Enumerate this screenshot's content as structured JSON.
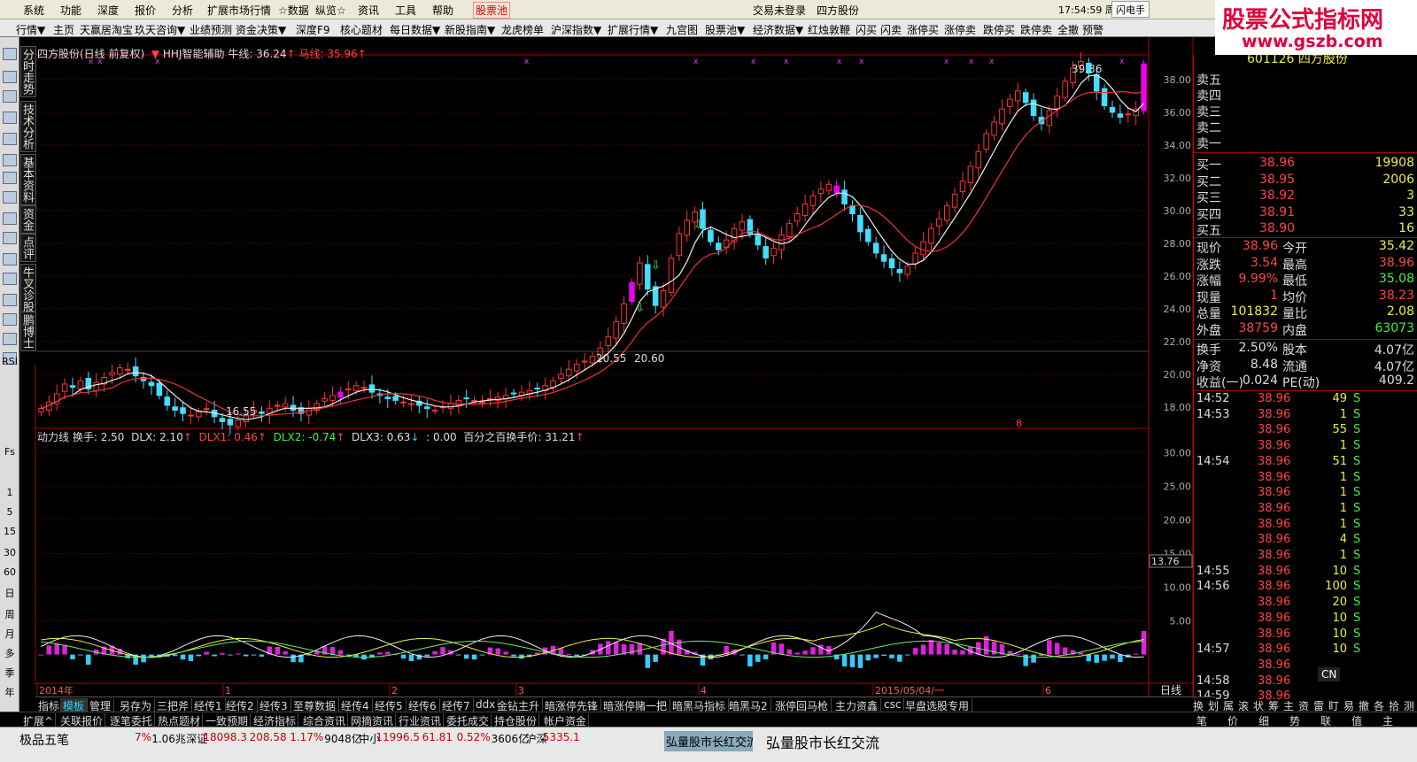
{
  "menubar": {
    "items": [
      "系统",
      "功能",
      "深度",
      "报价",
      "分析",
      "扩展市场行情",
      "☆数据",
      "纵览☆",
      "资讯",
      "工具",
      "帮助"
    ],
    "hot": "股票池",
    "login": "交易未登录",
    "stock": "四方股份",
    "clock": "17:54:59 周日",
    "flash": "闪电手"
  },
  "logo": {
    "line1": "股票公式指标网",
    "line2": "www.gszb.com"
  },
  "toolbar": [
    "行情▼",
    "主页",
    "天赢居淘宝",
    "玖天咨询▼",
    "业绩预测",
    "资金决策▼",
    "深度F9",
    "核心题材",
    "每日数据▼",
    "新股指南▼",
    "龙虎榜单",
    "沪深指数▼",
    "扩展行情▼",
    "九宫图",
    "股票池▼",
    "经济数据▼",
    "红烛敦鞭",
    "闪买",
    "闪卖",
    "涨停买",
    "涨停卖",
    "跌停买",
    "跌停卖",
    "全撤",
    "预警"
  ],
  "vtabs": [
    "分时走势",
    "技术分析",
    "基本资料",
    "资金",
    "点评",
    "牛叉诊股",
    "鹏博士"
  ],
  "leftbar": {
    "labels": [
      "RSI",
      "Fs",
      "1",
      "5",
      "15",
      "30",
      "60",
      "日",
      "周",
      "月",
      "多",
      "季",
      "年"
    ]
  },
  "main_header": {
    "name": "四方股份(日线 前复权)",
    "indicator": "HHJ智能辅助",
    "niu_label": "牛线:",
    "niu_val": "36.24",
    "ma_label": "马线:",
    "ma_val": "35.96"
  },
  "sub_header": {
    "name": "动力线",
    "hs_label": "换手:",
    "hs_val": "2.50",
    "dlx_label": "DLX:",
    "dlx_val": "2.10",
    "dlx1_label": "DLX1:",
    "dlx1_val": "0.46",
    "dlx2_label": "DLX2:",
    "dlx2_val": "-0.74",
    "dlx3_label": "DLX3:",
    "dlx3_val": "0.63",
    "zero": ": 0.00",
    "pct_label": "百分之百换手价:",
    "pct_val": "31.21"
  },
  "chart_data": {
    "type": "candlestick",
    "main_axis": {
      "ticks": [
        "38.00",
        "36.00",
        "34.00",
        "32.00",
        "30.00",
        "28.00",
        "26.00",
        "24.00",
        "22.00",
        "20.00",
        "18.00"
      ],
      "ylim": [
        16.8,
        39.4
      ]
    },
    "sub_axis": {
      "ticks": [
        "30.00",
        "25.00",
        "20.00",
        "15.00",
        "13.76",
        "10.00",
        "5.00"
      ],
      "ylim": [
        -4,
        31.5
      ]
    },
    "annotations": {
      "high": "39.36",
      "low": "16.55",
      "mid1": "20.55",
      "mid2": "20.60",
      "marker": "8"
    },
    "x_labels": [
      "2014年",
      "1",
      "2",
      "3",
      "4",
      "2015/05/04/一",
      "6"
    ],
    "period": "日线",
    "series": {
      "close": [
        17.9,
        18.3,
        18.8,
        19.4,
        19.2,
        19.6,
        19.1,
        19.5,
        19.8,
        20.1,
        20.4,
        20.3,
        19.9,
        19.6,
        19.3,
        18.7,
        18.1,
        17.8,
        17.6,
        17.5,
        17.7,
        17.9,
        17.4,
        17.1,
        16.9,
        17.2,
        17.5,
        17.8,
        17.6,
        17.9,
        18.1,
        18.2,
        17.8,
        17.6,
        17.9,
        18.2,
        18.5,
        18.7,
        18.9,
        19.1,
        19.3,
        19.2,
        18.9,
        18.7,
        18.5,
        18.4,
        18.3,
        18.2,
        18.1,
        17.9,
        17.8,
        18.0,
        18.2,
        18.4,
        18.5,
        18.4,
        18.3,
        18.5,
        18.6,
        18.7,
        18.8,
        18.9,
        19.0,
        19.1,
        19.3,
        19.6,
        20.0,
        20.3,
        20.6,
        20.8,
        21.1,
        21.6,
        22.3,
        23.2,
        24.3,
        25.6,
        26.8,
        25.2,
        24.2,
        25.1,
        27.1,
        28.6,
        29.4,
        29.9,
        28.9,
        28.1,
        27.6,
        28.2,
        28.9,
        29.3,
        28.6,
        27.9,
        27.1,
        27.7,
        28.5,
        29.2,
        29.8,
        30.4,
        30.9,
        31.3,
        31.6,
        31.1,
        30.4,
        29.8,
        28.7,
        28.1,
        27.4,
        26.9,
        26.5,
        26.2,
        26.6,
        27.4,
        28.1,
        28.9,
        29.5,
        30.3,
        31.0,
        31.8,
        32.7,
        33.6,
        34.7,
        35.4,
        36.2,
        36.8,
        37.3,
        36.6,
        35.8,
        35.3,
        36.1,
        37.0,
        37.9,
        38.7,
        39.1,
        38.4,
        37.3,
        36.4,
        36.0,
        35.7,
        35.9,
        36.2,
        38.96
      ],
      "ma_short_label": "牛线",
      "ma_long_label": "马线"
    }
  },
  "quote": {
    "title": "601126 四方股份",
    "sell": [
      {
        "label": "卖五",
        "price": "",
        "vol": ""
      },
      {
        "label": "卖四",
        "price": "",
        "vol": ""
      },
      {
        "label": "卖三",
        "price": "",
        "vol": ""
      },
      {
        "label": "卖二",
        "price": "",
        "vol": ""
      },
      {
        "label": "卖一",
        "price": "",
        "vol": ""
      }
    ],
    "buy": [
      {
        "label": "买一",
        "price": "38.96",
        "vol": "19908"
      },
      {
        "label": "买二",
        "price": "38.95",
        "vol": "2006"
      },
      {
        "label": "买三",
        "price": "38.92",
        "vol": "3"
      },
      {
        "label": "买四",
        "price": "38.91",
        "vol": "33"
      },
      {
        "label": "买五",
        "price": "38.90",
        "vol": "16"
      }
    ],
    "stats": [
      {
        "l1": "现价",
        "v1": "38.96",
        "l2": "今开",
        "v2": "35.42"
      },
      {
        "l1": "涨跌",
        "v1": "3.54",
        "l2": "最高",
        "v2": "38.96"
      },
      {
        "l1": "涨幅",
        "v1": "9.99%",
        "l2": "最低",
        "v2": "35.08"
      },
      {
        "l1": "现量",
        "v1": "1",
        "l2": "均价",
        "v2": "38.23"
      },
      {
        "l1": "总量",
        "v1": "101832",
        "l2": "量比",
        "v2": "2.08"
      },
      {
        "l1": "外盘",
        "v1": "38759",
        "l2": "内盘",
        "v2": "63073"
      }
    ],
    "stats2": [
      {
        "l1": "换手",
        "v1": "2.50%",
        "l2": "股本",
        "v2": "4.07亿"
      },
      {
        "l1": "净资",
        "v1": "8.48",
        "l2": "流通",
        "v2": "4.07亿"
      },
      {
        "l1": "收益(一)",
        "v1": "0.024",
        "l2": "PE(动)",
        "v2": "409.2"
      }
    ],
    "ticks": [
      {
        "t": "14:52",
        "p": "38.96",
        "v": "49",
        "s": "S"
      },
      {
        "t": "14:53",
        "p": "38.96",
        "v": "1",
        "s": "S"
      },
      {
        "t": "",
        "p": "38.96",
        "v": "55",
        "s": "S"
      },
      {
        "t": "",
        "p": "38.96",
        "v": "1",
        "s": "S"
      },
      {
        "t": "14:54",
        "p": "38.96",
        "v": "51",
        "s": "S"
      },
      {
        "t": "",
        "p": "38.96",
        "v": "1",
        "s": "S"
      },
      {
        "t": "",
        "p": "38.96",
        "v": "1",
        "s": "S"
      },
      {
        "t": "",
        "p": "38.96",
        "v": "1",
        "s": "S"
      },
      {
        "t": "",
        "p": "38.96",
        "v": "1",
        "s": "S"
      },
      {
        "t": "",
        "p": "38.96",
        "v": "4",
        "s": "S"
      },
      {
        "t": "",
        "p": "38.96",
        "v": "1",
        "s": "S"
      },
      {
        "t": "14:55",
        "p": "38.96",
        "v": "10",
        "s": "S"
      },
      {
        "t": "14:56",
        "p": "38.96",
        "v": "100",
        "s": "S"
      },
      {
        "t": "",
        "p": "38.96",
        "v": "20",
        "s": "S"
      },
      {
        "t": "",
        "p": "38.96",
        "v": "10",
        "s": "S"
      },
      {
        "t": "",
        "p": "38.96",
        "v": "10",
        "s": "S"
      },
      {
        "t": "14:57",
        "p": "38.96",
        "v": "10",
        "s": "S"
      },
      {
        "t": "",
        "p": "38.96",
        "v": "",
        "s": ""
      },
      {
        "t": "14:58",
        "p": "38.96",
        "v": "",
        "s": ""
      },
      {
        "t": "14:59",
        "p": "38.96",
        "v": "",
        "s": ""
      }
    ]
  },
  "bottom_tabs": [
    "指标",
    "模板",
    "管理",
    "另存为",
    "三把斧",
    "经传1",
    "经传2",
    "经传3",
    "至尊数据",
    "经传4",
    "经传5",
    "经传6",
    "经传7",
    "ddx",
    "金钻主升",
    "暗涨停先锋",
    "暗涨停赌一把",
    "暗黑马指标",
    "暗黑马2",
    "涨停回马枪",
    "主力资鑫",
    "csc",
    "早盘选股专用"
  ],
  "bottom_tabs2": [
    "扩展^",
    "关联报价",
    "逐笔委托",
    "热点题材",
    "一致预期",
    "经济指标",
    "综合资讯",
    "网摘资讯",
    "行业资讯",
    "委托成交",
    "持仓股份",
    "帐户资金"
  ],
  "right_buttons": [
    "换",
    "划",
    "属",
    "滚",
    "状",
    "筹",
    "主",
    "资",
    "雷",
    "盯",
    "易",
    "撤",
    "各",
    "拾",
    "测"
  ],
  "right_buttons2": [
    "笔",
    "价",
    "细",
    "势",
    "联",
    "值",
    "主"
  ],
  "taskbar": {
    "app": "极品五笔",
    "items": [
      {
        "label": "7%",
        "cls": "r"
      },
      {
        "label": "1.06兆",
        "cls": "k"
      },
      {
        "label": "深证",
        "cls": "k"
      },
      {
        "label": "18098.3",
        "cls": "r"
      },
      {
        "label": "208.58",
        "cls": "r"
      },
      {
        "label": "1.17%",
        "cls": "r"
      },
      {
        "label": "9048亿",
        "cls": "k"
      },
      {
        "label": "中小",
        "cls": "k"
      },
      {
        "label": "11996.5",
        "cls": "r"
      },
      {
        "label": "61.81",
        "cls": "r"
      },
      {
        "label": "0.52%",
        "cls": "r"
      },
      {
        "label": "3606亿",
        "cls": "k"
      },
      {
        "label": "沪深",
        "cls": "k"
      },
      {
        "label": "5335.1",
        "cls": "r"
      }
    ],
    "window": "弘量股市长红交流",
    "window2": "弘量股市长红交流",
    "cn": "CN"
  }
}
